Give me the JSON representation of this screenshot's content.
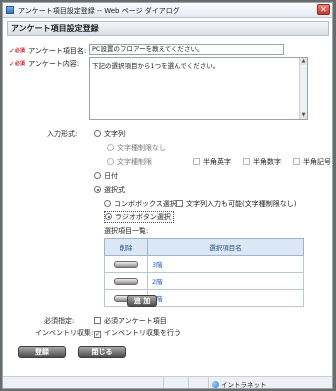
{
  "window": {
    "title": "アンケート項目設定登録 -- Web ページ ダイアログ",
    "close_glyph": "✕"
  },
  "page": {
    "title": "アンケート項目設定登録"
  },
  "required_mark": "✓",
  "required_mark_text": "必須",
  "form": {
    "item_name_label": "アンケート項目名:",
    "item_name_value": "PC設置のフロアーを教えてください。",
    "content_label": "アンケート内容:",
    "content_value": "下記の選択項目から1つを選んでください。",
    "input_format_label": "入力形式:",
    "opt_text": "文字列",
    "opt_text_unlimited": "文字種制限なし",
    "opt_text_limited": "文字種制限",
    "chk_halfwidth_alpha": "半角英字",
    "chk_halfwidth_digit": "半角数字",
    "chk_halfwidth_symbol": "半角記号",
    "opt_date": "日付",
    "opt_select": "選択式",
    "opt_combobox": "コンボボックス選択",
    "chk_text_input": "文字列入力も可能(文字種制限なし)",
    "opt_radio": "ラジオボタン選択",
    "list_caption": "選択項目一覧:",
    "list_headers": [
      "削除",
      "選択項目名"
    ],
    "list_rows": [
      {
        "name": "3階"
      },
      {
        "name": "2階"
      },
      {
        "name": "1階"
      }
    ],
    "add_button": "追 加",
    "required_label": "必須指定:",
    "required_check": "必須アンケート項目",
    "inventory_label": "インベントリ収集:",
    "inventory_check": "インベントリ収集を行う",
    "check_glyph": "✓"
  },
  "buttons": {
    "register": "登録",
    "close": "閉じる"
  },
  "status": {
    "zone": "イントラネット"
  }
}
